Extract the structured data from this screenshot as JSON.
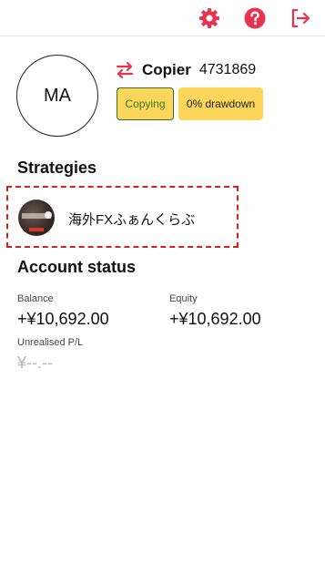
{
  "header": {
    "settings_icon": "gear-icon",
    "help_icon": "question-mark-icon",
    "logout_icon": "logout-arrow-icon",
    "accent_color": "#e8344e"
  },
  "profile": {
    "initials": "MA",
    "role_icon": "swap-arrows-icon",
    "role": "Copier",
    "account_id": "4731869",
    "badges": {
      "status": "Copying",
      "drawdown": "0% drawdown"
    }
  },
  "strategies": {
    "title": "Strategies",
    "items": [
      {
        "name": "海外FXふぁんくらぶ"
      }
    ]
  },
  "account_status": {
    "title": "Account status",
    "balance_label": "Balance",
    "balance_value": "+¥10,692.00",
    "equity_label": "Equity",
    "equity_value": "+¥10,692.00",
    "unrealised_label": "Unrealised P/L",
    "unrealised_value": "¥--.--"
  },
  "colors": {
    "badge_bg": "#fbd65a",
    "copying_text": "#3a7a1a",
    "highlight_border": "#d42020"
  }
}
